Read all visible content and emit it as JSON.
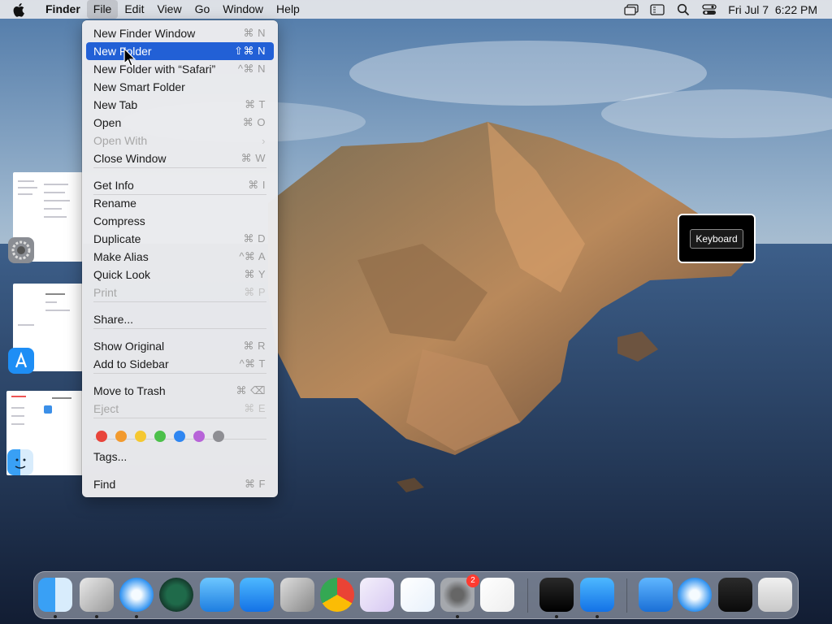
{
  "menubar": {
    "app_name": "Finder",
    "menus": [
      "File",
      "Edit",
      "View",
      "Go",
      "Window",
      "Help"
    ],
    "active_menu": "File",
    "clock": "Fri Jul 7  6:22 PM"
  },
  "file_menu": {
    "items": [
      {
        "label": "New Finder Window",
        "shortcut": "⌘ N",
        "state": "normal"
      },
      {
        "label": "New Folder",
        "shortcut": "⇧⌘ N",
        "state": "selected"
      },
      {
        "label": "New Folder with “Safari”",
        "shortcut": "^⌘ N",
        "state": "normal"
      },
      {
        "label": "New Smart Folder",
        "shortcut": "",
        "state": "normal"
      },
      {
        "label": "New Tab",
        "shortcut": "⌘ T",
        "state": "normal"
      },
      {
        "label": "Open",
        "shortcut": "⌘ O",
        "state": "normal"
      },
      {
        "label": "Open With",
        "shortcut": "›",
        "state": "disabled"
      },
      {
        "label": "Close Window",
        "shortcut": "⌘ W",
        "state": "normal"
      },
      {
        "label": "Get Info",
        "shortcut": "⌘ I",
        "state": "normal"
      },
      {
        "label": "Rename",
        "shortcut": "",
        "state": "normal"
      },
      {
        "label": "Compress",
        "shortcut": "",
        "state": "normal"
      },
      {
        "label": "Duplicate",
        "shortcut": "⌘ D",
        "state": "normal"
      },
      {
        "label": "Make Alias",
        "shortcut": "^⌘ A",
        "state": "normal"
      },
      {
        "label": "Quick Look",
        "shortcut": "⌘ Y",
        "state": "normal"
      },
      {
        "label": "Print",
        "shortcut": "⌘ P",
        "state": "disabled"
      },
      {
        "label": "Share...",
        "shortcut": "",
        "state": "normal"
      },
      {
        "label": "Show Original",
        "shortcut": "⌘ R",
        "state": "normal"
      },
      {
        "label": "Add to Sidebar",
        "shortcut": "^⌘ T",
        "state": "normal"
      },
      {
        "label": "Move to Trash",
        "shortcut": "⌘ ⌫",
        "state": "normal"
      },
      {
        "label": "Eject",
        "shortcut": "⌘ E",
        "state": "disabled"
      },
      {
        "label": "Tags...",
        "shortcut": "",
        "state": "normal"
      },
      {
        "label": "Find",
        "shortcut": "⌘ F",
        "state": "normal"
      }
    ],
    "tag_colors": [
      "#e8443a",
      "#f29a2e",
      "#f5c831",
      "#4cc04a",
      "#2f86f1",
      "#b763d8",
      "#8e8e93"
    ]
  },
  "keyboard_viewer": {
    "label": "Keyboard"
  },
  "dock": {
    "items": [
      {
        "name": "finder-icon",
        "running": true
      },
      {
        "name": "xcode-instruments-icon",
        "running": true
      },
      {
        "name": "safari-icon",
        "running": true
      },
      {
        "name": "time-machine-icon",
        "running": false
      },
      {
        "name": "testflight-icon",
        "running": false
      },
      {
        "name": "app-store-icon",
        "running": false
      },
      {
        "name": "automator-icon",
        "running": false
      },
      {
        "name": "chrome-icon",
        "running": false
      },
      {
        "name": "visual-studio-icon",
        "running": false
      },
      {
        "name": "vscode-icon",
        "running": false
      },
      {
        "name": "system-preferences-icon",
        "running": true,
        "badge": "2"
      },
      {
        "name": "launchpad-icon",
        "running": false
      },
      {
        "name": "terminal-icon",
        "running": true
      },
      {
        "name": "app-store-icon",
        "running": true
      },
      {
        "name": "xcode-icon",
        "running": false
      },
      {
        "name": "safari-icon",
        "running": false
      },
      {
        "name": "activity-monitor-icon",
        "running": false
      },
      {
        "name": "trash-icon",
        "running": false
      }
    ]
  }
}
